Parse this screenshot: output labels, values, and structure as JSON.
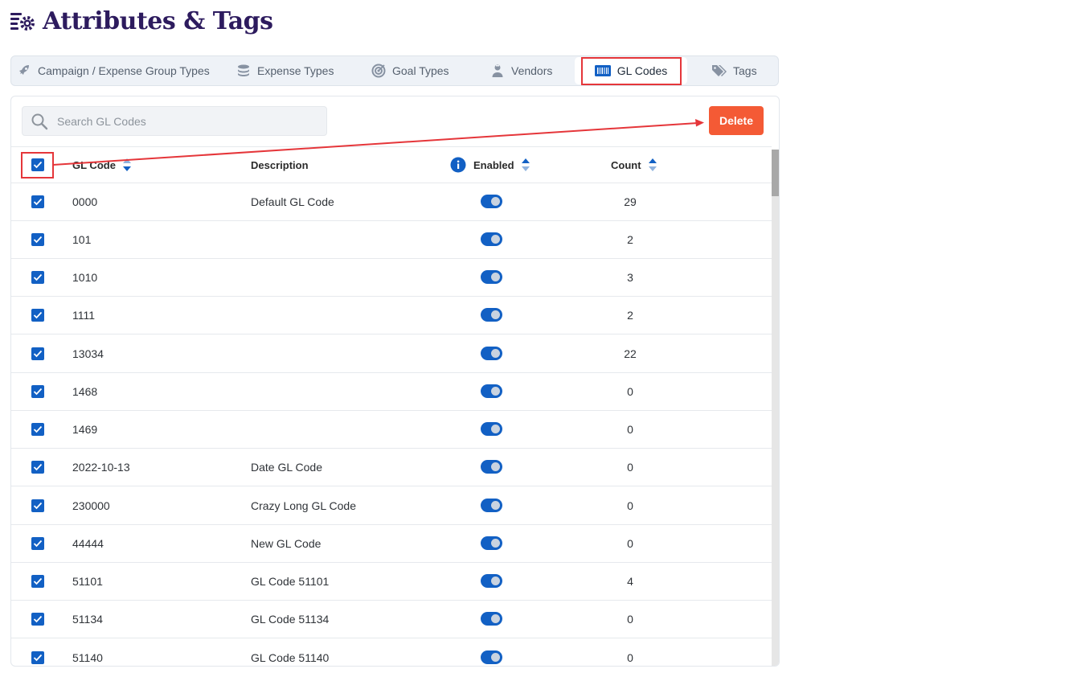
{
  "page": {
    "title": "Attributes & Tags"
  },
  "tabs": [
    {
      "label": "Campaign / Expense Group Types",
      "icon": "rocket-icon"
    },
    {
      "label": "Expense Types",
      "icon": "coins-icon"
    },
    {
      "label": "Goal Types",
      "icon": "target-icon"
    },
    {
      "label": "Vendors",
      "icon": "person-icon"
    },
    {
      "label": "GL Codes",
      "icon": "barcode-icon",
      "active": true
    },
    {
      "label": "Tags",
      "icon": "tags-icon"
    }
  ],
  "search": {
    "placeholder": "Search GL Codes",
    "value": ""
  },
  "toolbar": {
    "delete_label": "Delete"
  },
  "table": {
    "headers": {
      "gl_code": "GL Code",
      "description": "Description",
      "enabled": "Enabled",
      "count": "Count"
    },
    "select_all_checked": true,
    "rows": [
      {
        "code": "0000",
        "description": "Default GL Code",
        "enabled": true,
        "count": "29",
        "checked": true
      },
      {
        "code": "101",
        "description": "",
        "enabled": true,
        "count": "2",
        "checked": true
      },
      {
        "code": "1010",
        "description": "",
        "enabled": true,
        "count": "3",
        "checked": true
      },
      {
        "code": "1111",
        "description": "",
        "enabled": true,
        "count": "2",
        "checked": true
      },
      {
        "code": "13034",
        "description": "",
        "enabled": true,
        "count": "22",
        "checked": true
      },
      {
        "code": "1468",
        "description": "",
        "enabled": true,
        "count": "0",
        "checked": true
      },
      {
        "code": "1469",
        "description": "",
        "enabled": true,
        "count": "0",
        "checked": true
      },
      {
        "code": "2022-10-13",
        "description": "Date GL Code",
        "enabled": true,
        "count": "0",
        "checked": true
      },
      {
        "code": "230000",
        "description": "Crazy Long GL Code",
        "enabled": true,
        "count": "0",
        "checked": true
      },
      {
        "code": "44444",
        "description": "New GL Code",
        "enabled": true,
        "count": "0",
        "checked": true
      },
      {
        "code": "51101",
        "description": "GL Code 51101",
        "enabled": true,
        "count": "4",
        "checked": true
      },
      {
        "code": "51134",
        "description": "GL Code 51134",
        "enabled": true,
        "count": "0",
        "checked": true
      },
      {
        "code": "51140",
        "description": "GL Code 51140",
        "enabled": true,
        "count": "0",
        "checked": true
      }
    ]
  },
  "colors": {
    "accent": "#1260c4",
    "delete": "#f45a35",
    "highlight": "#e5363a",
    "title": "#2d1b5e"
  }
}
